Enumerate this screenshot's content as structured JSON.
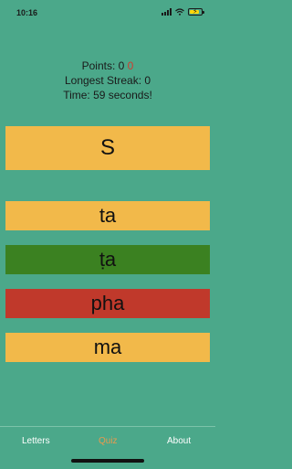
{
  "status": {
    "time": "10:16"
  },
  "stats": {
    "points_label": "Points: 0",
    "points_delta": "0",
    "streak": "Longest Streak: 0",
    "time": "Time: 59 seconds!"
  },
  "quiz": {
    "prompt": "S",
    "options": [
      {
        "label": "ta",
        "state": "neutral",
        "color": "#f2b94a"
      },
      {
        "label": "ṭa",
        "state": "correct",
        "color": "#3b8121"
      },
      {
        "label": "pha",
        "state": "wrong",
        "color": "#c0392b"
      },
      {
        "label": "ma",
        "state": "neutral",
        "color": "#f2b94a"
      }
    ],
    "prompt_color": "#f2b94a"
  },
  "tabs": [
    {
      "label": "Letters",
      "color": "#ffffff"
    },
    {
      "label": "Quiz",
      "color": "#e89a4f",
      "active": true
    },
    {
      "label": "About",
      "color": "#ffffff"
    }
  ],
  "colors": {
    "background": "#4ba88a",
    "accent_red": "#d23b2e"
  }
}
